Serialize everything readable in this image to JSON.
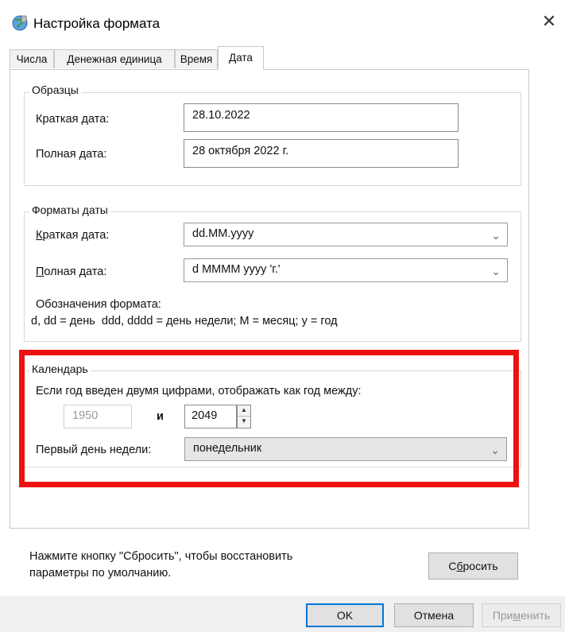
{
  "window": {
    "title": "Настройка формата",
    "close_glyph": "✕"
  },
  "tabs": [
    {
      "label": "Числа"
    },
    {
      "label": "Денежная единица"
    },
    {
      "label": "Время"
    },
    {
      "label": "Дата",
      "active": true
    }
  ],
  "samples": {
    "legend": "Образцы",
    "short_label": "Краткая дата:",
    "short_value": "28.10.2022",
    "long_label": "Полная дата:",
    "long_value": "28 октября 2022 г."
  },
  "date_formats": {
    "legend": "Форматы даты",
    "short_label_u": "К",
    "short_label_rest": "раткая дата:",
    "short_value": "dd.MM.yyyy",
    "long_label_u": "П",
    "long_label_rest": "олная дата:",
    "long_value": "d MMMM yyyy 'г.'",
    "notation_title": "Обозначения формата:",
    "notation_text": "d, dd = день  ddd, dddd = день недели; M = месяц; y = год"
  },
  "calendar": {
    "legend": "Календарь",
    "two_digit_label": "Если год введен двумя цифрами, отображать как год между:",
    "year_from": "1950",
    "and_label": "и",
    "year_to": "2049",
    "first_day_label": "Первый день недели:",
    "first_day_value": "понедельник"
  },
  "reset": {
    "text_line1": "Нажмите кнопку \"Сбросить\", чтобы восстановить",
    "text_line2": "параметры по умолчанию.",
    "button_pre": "С",
    "button_u": "б",
    "button_post": "росить"
  },
  "footer": {
    "ok": "OK",
    "cancel": "Отмена",
    "apply_pre": "При",
    "apply_u": "м",
    "apply_post": "енить"
  },
  "colors": {
    "highlight_frame": "#ee1111",
    "accent": "#0078d7"
  },
  "icons": {
    "title": "globe-settings-icon",
    "close": "close-icon",
    "dropdown": "chevron-down-icon",
    "spin_up": "spin-up-icon",
    "spin_down": "spin-down-icon"
  }
}
